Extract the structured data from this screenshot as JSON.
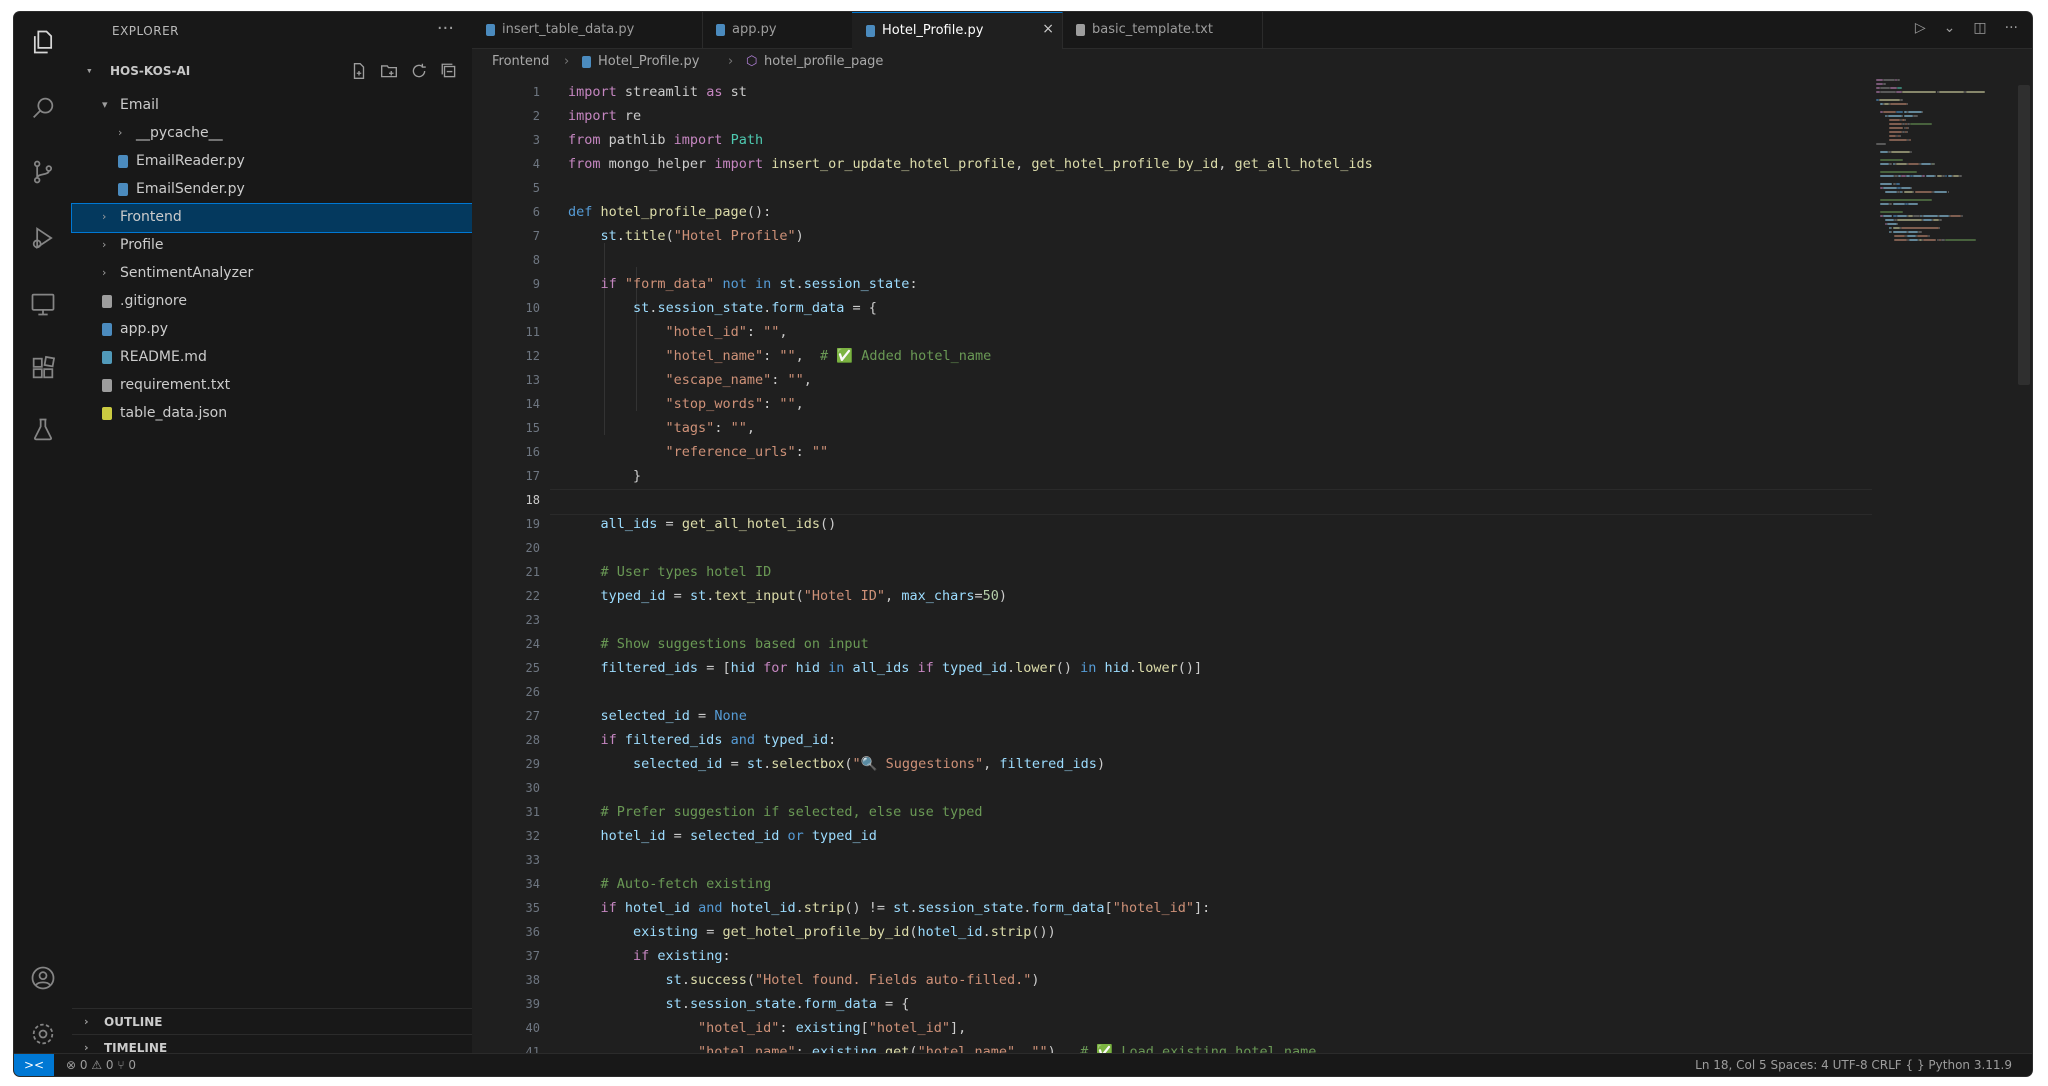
{
  "explorer": {
    "title": "EXPLORER",
    "project": "HOS-KOS-AI",
    "items": [
      {
        "label": "Email",
        "kind": "folder-open",
        "indent": 1
      },
      {
        "label": "__pycache__",
        "kind": "folder",
        "indent": 2
      },
      {
        "label": "EmailReader.py",
        "kind": "python",
        "indent": 2
      },
      {
        "label": "EmailSender.py",
        "kind": "python",
        "indent": 2
      },
      {
        "label": "Frontend",
        "kind": "folder",
        "indent": 1,
        "selected": true
      },
      {
        "label": "Profile",
        "kind": "folder",
        "indent": 1
      },
      {
        "label": "SentimentAnalyzer",
        "kind": "folder",
        "indent": 1
      },
      {
        "label": ".gitignore",
        "kind": "git",
        "indent": 1
      },
      {
        "label": "app.py",
        "kind": "python",
        "indent": 1
      },
      {
        "label": "README.md",
        "kind": "info",
        "indent": 1
      },
      {
        "label": "requirement.txt",
        "kind": "text",
        "indent": 1
      },
      {
        "label": "table_data.json",
        "kind": "json",
        "indent": 1
      }
    ],
    "outline_label": "OUTLINE",
    "timeline_label": "TIMELINE"
  },
  "tabs": [
    {
      "label": "insert_table_data.py",
      "active": false,
      "icon_color": "#4b8bbe"
    },
    {
      "label": "app.py",
      "active": false,
      "icon_color": "#4b8bbe"
    },
    {
      "label": "Hotel_Profile.py",
      "active": true,
      "icon_color": "#4b8bbe"
    },
    {
      "label": "basic_template.txt",
      "active": false,
      "icon_color": "#9d9d9d"
    }
  ],
  "breadcrumb": [
    "Frontend",
    "Hotel_Profile.py",
    "hotel_profile_page"
  ],
  "editor": {
    "current_line": 18,
    "lines": [
      [
        [
          "kw2",
          "import"
        ],
        [
          "t",
          " streamlit "
        ],
        [
          "kw2",
          "as"
        ],
        [
          "t",
          " st"
        ]
      ],
      [
        [
          "kw2",
          "import"
        ],
        [
          "t",
          " re"
        ]
      ],
      [
        [
          "kw2",
          "from"
        ],
        [
          "t",
          " pathlib "
        ],
        [
          "kw2",
          "import"
        ],
        [
          "cls",
          " Path"
        ]
      ],
      [
        [
          "kw2",
          "from"
        ],
        [
          "t",
          " mongo_helper "
        ],
        [
          "kw2",
          "import"
        ],
        [
          "fn",
          " insert_or_update_hotel_profile"
        ],
        [
          "t",
          ", "
        ],
        [
          "fn",
          "get_hotel_profile_by_id"
        ],
        [
          "t",
          ", "
        ],
        [
          "fn",
          "get_all_hotel_ids"
        ]
      ],
      [],
      [
        [
          "kw",
          "def"
        ],
        [
          "fn",
          " hotel_profile_page"
        ],
        [
          "t",
          "():"
        ]
      ],
      [
        [
          "t",
          "    "
        ],
        [
          "var",
          "st"
        ],
        [
          "t",
          "."
        ],
        [
          "fn",
          "title"
        ],
        [
          "t",
          "("
        ],
        [
          "str",
          "\"Hotel Profile\""
        ],
        [
          "t",
          ")"
        ]
      ],
      [],
      [
        [
          "t",
          "    "
        ],
        [
          "kw2",
          "if"
        ],
        [
          "str",
          " \"form_data\""
        ],
        [
          "kw",
          " not in"
        ],
        [
          "var",
          " st"
        ],
        [
          "t",
          "."
        ],
        [
          "var",
          "session_state"
        ],
        [
          "t",
          ":"
        ]
      ],
      [
        [
          "t",
          "        "
        ],
        [
          "var",
          "st"
        ],
        [
          "t",
          "."
        ],
        [
          "var",
          "session_state"
        ],
        [
          "t",
          "."
        ],
        [
          "var",
          "form_data"
        ],
        [
          "t",
          " = {"
        ]
      ],
      [
        [
          "t",
          "            "
        ],
        [
          "str",
          "\"hotel_id\""
        ],
        [
          "t",
          ": "
        ],
        [
          "str",
          "\"\""
        ],
        [
          "t",
          ","
        ]
      ],
      [
        [
          "t",
          "            "
        ],
        [
          "str",
          "\"hotel_name\""
        ],
        [
          "t",
          ": "
        ],
        [
          "str",
          "\"\""
        ],
        [
          "t",
          ",  "
        ],
        [
          "cm",
          "# ✅ Added hotel_name"
        ]
      ],
      [
        [
          "t",
          "            "
        ],
        [
          "str",
          "\"escape_name\""
        ],
        [
          "t",
          ": "
        ],
        [
          "str",
          "\"\""
        ],
        [
          "t",
          ","
        ]
      ],
      [
        [
          "t",
          "            "
        ],
        [
          "str",
          "\"stop_words\""
        ],
        [
          "t",
          ": "
        ],
        [
          "str",
          "\"\""
        ],
        [
          "t",
          ","
        ]
      ],
      [
        [
          "t",
          "            "
        ],
        [
          "str",
          "\"tags\""
        ],
        [
          "t",
          ": "
        ],
        [
          "str",
          "\"\""
        ],
        [
          "t",
          ","
        ]
      ],
      [
        [
          "t",
          "            "
        ],
        [
          "str",
          "\"reference_urls\""
        ],
        [
          "t",
          ": "
        ],
        [
          "str",
          "\"\""
        ]
      ],
      [
        [
          "t",
          "        }"
        ]
      ],
      [],
      [
        [
          "t",
          "    "
        ],
        [
          "var",
          "all_ids"
        ],
        [
          "t",
          " = "
        ],
        [
          "fn",
          "get_all_hotel_ids"
        ],
        [
          "t",
          "()"
        ]
      ],
      [],
      [
        [
          "t",
          "    "
        ],
        [
          "cm",
          "# User types hotel ID"
        ]
      ],
      [
        [
          "t",
          "    "
        ],
        [
          "var",
          "typed_id"
        ],
        [
          "t",
          " = "
        ],
        [
          "var",
          "st"
        ],
        [
          "t",
          "."
        ],
        [
          "fn",
          "text_input"
        ],
        [
          "t",
          "("
        ],
        [
          "str",
          "\"Hotel ID\""
        ],
        [
          "t",
          ", "
        ],
        [
          "var",
          "max_chars"
        ],
        [
          "t",
          "="
        ],
        [
          "num",
          "50"
        ],
        [
          "t",
          ")"
        ]
      ],
      [],
      [
        [
          "t",
          "    "
        ],
        [
          "cm",
          "# Show suggestions based on input"
        ]
      ],
      [
        [
          "t",
          "    "
        ],
        [
          "var",
          "filtered_ids"
        ],
        [
          "t",
          " = ["
        ],
        [
          "var",
          "hid"
        ],
        [
          "kw2",
          " for"
        ],
        [
          "var",
          " hid"
        ],
        [
          "kw",
          " in"
        ],
        [
          "var",
          " all_ids"
        ],
        [
          "kw2",
          " if"
        ],
        [
          "var",
          " typed_id"
        ],
        [
          "t",
          "."
        ],
        [
          "fn",
          "lower"
        ],
        [
          "t",
          "() "
        ],
        [
          "kw",
          "in"
        ],
        [
          "var",
          " hid"
        ],
        [
          "t",
          "."
        ],
        [
          "fn",
          "lower"
        ],
        [
          "t",
          "()]"
        ]
      ],
      [],
      [
        [
          "t",
          "    "
        ],
        [
          "var",
          "selected_id"
        ],
        [
          "t",
          " = "
        ],
        [
          "kw",
          "None"
        ]
      ],
      [
        [
          "t",
          "    "
        ],
        [
          "kw2",
          "if"
        ],
        [
          "var",
          " filtered_ids"
        ],
        [
          "kw",
          " and"
        ],
        [
          "var",
          " typed_id"
        ],
        [
          "t",
          ":"
        ]
      ],
      [
        [
          "t",
          "        "
        ],
        [
          "var",
          "selected_id"
        ],
        [
          "t",
          " = "
        ],
        [
          "var",
          "st"
        ],
        [
          "t",
          "."
        ],
        [
          "fn",
          "selectbox"
        ],
        [
          "t",
          "("
        ],
        [
          "str",
          "\"🔍 Suggestions\""
        ],
        [
          "t",
          ", "
        ],
        [
          "var",
          "filtered_ids"
        ],
        [
          "t",
          ")"
        ]
      ],
      [],
      [
        [
          "t",
          "    "
        ],
        [
          "cm",
          "# Prefer suggestion if selected, else use typed"
        ]
      ],
      [
        [
          "t",
          "    "
        ],
        [
          "var",
          "hotel_id"
        ],
        [
          "t",
          " = "
        ],
        [
          "var",
          "selected_id"
        ],
        [
          "kw",
          " or"
        ],
        [
          "var",
          " typed_id"
        ]
      ],
      [],
      [
        [
          "t",
          "    "
        ],
        [
          "cm",
          "# Auto-fetch existing"
        ]
      ],
      [
        [
          "t",
          "    "
        ],
        [
          "kw2",
          "if"
        ],
        [
          "var",
          " hotel_id"
        ],
        [
          "kw",
          " and"
        ],
        [
          "var",
          " hotel_id"
        ],
        [
          "t",
          "."
        ],
        [
          "fn",
          "strip"
        ],
        [
          "t",
          "() != "
        ],
        [
          "var",
          "st"
        ],
        [
          "t",
          "."
        ],
        [
          "var",
          "session_state"
        ],
        [
          "t",
          "."
        ],
        [
          "var",
          "form_data"
        ],
        [
          "t",
          "["
        ],
        [
          "str",
          "\"hotel_id\""
        ],
        [
          "t",
          "]:"
        ]
      ],
      [
        [
          "t",
          "        "
        ],
        [
          "var",
          "existing"
        ],
        [
          "t",
          " = "
        ],
        [
          "fn",
          "get_hotel_profile_by_id"
        ],
        [
          "t",
          "("
        ],
        [
          "var",
          "hotel_id"
        ],
        [
          "t",
          "."
        ],
        [
          "fn",
          "strip"
        ],
        [
          "t",
          "())"
        ]
      ],
      [
        [
          "t",
          "        "
        ],
        [
          "kw2",
          "if"
        ],
        [
          "var",
          " existing"
        ],
        [
          "t",
          ":"
        ]
      ],
      [
        [
          "t",
          "            "
        ],
        [
          "var",
          "st"
        ],
        [
          "t",
          "."
        ],
        [
          "fn",
          "success"
        ],
        [
          "t",
          "("
        ],
        [
          "str",
          "\"Hotel found. Fields auto-filled.\""
        ],
        [
          "t",
          ")"
        ]
      ],
      [
        [
          "t",
          "            "
        ],
        [
          "var",
          "st"
        ],
        [
          "t",
          "."
        ],
        [
          "var",
          "session_state"
        ],
        [
          "t",
          "."
        ],
        [
          "var",
          "form_data"
        ],
        [
          "t",
          " = {"
        ]
      ],
      [
        [
          "t",
          "                "
        ],
        [
          "str",
          "\"hotel_id\""
        ],
        [
          "t",
          ": "
        ],
        [
          "var",
          "existing"
        ],
        [
          "t",
          "["
        ],
        [
          "str",
          "\"hotel_id\""
        ],
        [
          "t",
          "],"
        ]
      ],
      [
        [
          "t",
          "                "
        ],
        [
          "str",
          "\"hotel_name\""
        ],
        [
          "t",
          ": "
        ],
        [
          "var",
          "existing"
        ],
        [
          "t",
          "."
        ],
        [
          "fn",
          "get"
        ],
        [
          "t",
          "("
        ],
        [
          "str",
          "\"hotel_name\""
        ],
        [
          "t",
          ", "
        ],
        [
          "str",
          "\"\""
        ],
        [
          "t",
          "),  "
        ],
        [
          "cm",
          "# ✅ Load existing hotel_name"
        ]
      ]
    ]
  },
  "status": {
    "remote": "><",
    "left": "⊗ 0  ⚠ 0    ⑂ 0",
    "right": "Ln 18, Col 5   Spaces: 4   UTF-8   CRLF   { } Python   3.11.9"
  },
  "colors": {
    "accent": "#0078d4",
    "selection": "#04395e",
    "editor_bg": "#1f1f1f",
    "chrome_bg": "#181818"
  }
}
